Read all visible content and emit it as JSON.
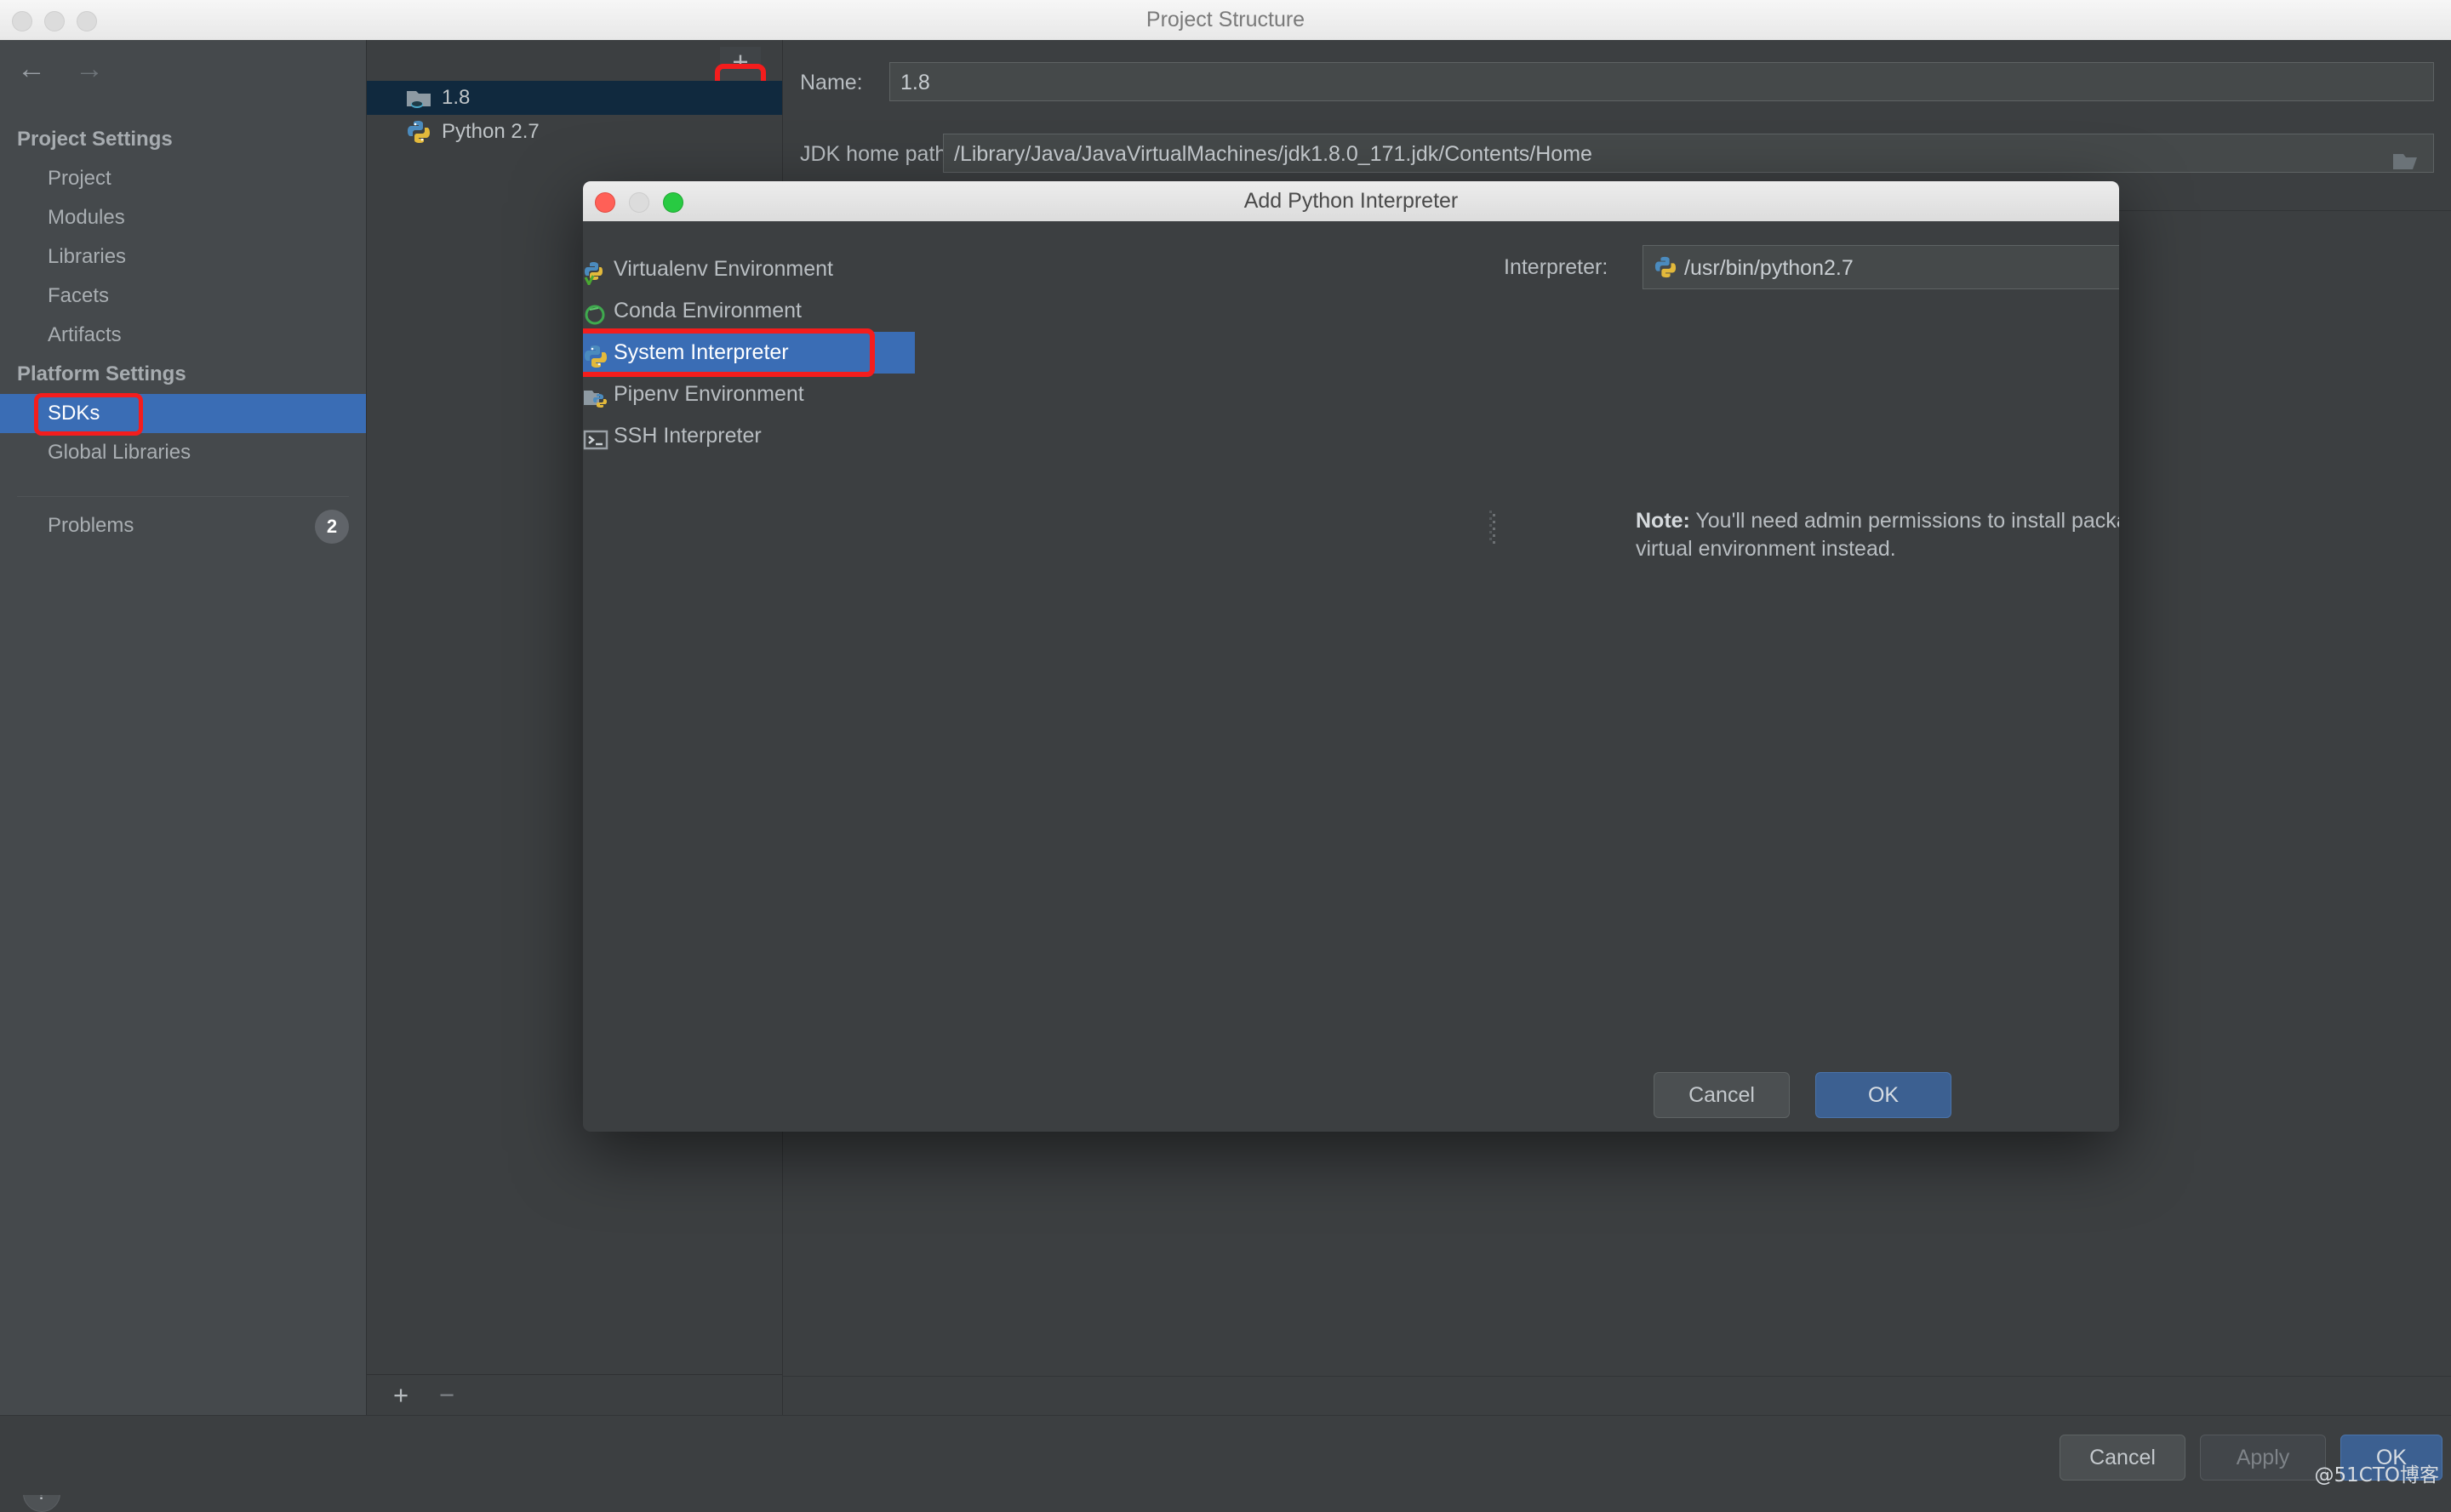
{
  "window": {
    "title": "Project Structure",
    "nav": {
      "back": "←",
      "forward": "→"
    }
  },
  "sidebar": {
    "groups": [
      {
        "label": "Project Settings",
        "items": [
          "Project",
          "Modules",
          "Libraries",
          "Facets",
          "Artifacts"
        ]
      },
      {
        "label": "Platform Settings",
        "items": [
          "SDKs",
          "Global Libraries"
        ]
      }
    ],
    "selected": "SDKs",
    "problems": {
      "label": "Problems",
      "count": "2"
    },
    "help_glyph": "?"
  },
  "sdk_list": {
    "toolbar": {
      "add": "+",
      "remove": "−"
    },
    "items": [
      {
        "name": "1.8",
        "icon": "java-sdk-icon",
        "selected": true
      },
      {
        "name": "Python 2.7",
        "icon": "python-icon",
        "selected": false
      }
    ],
    "bottom_toolbar": {
      "add": "+",
      "remove": "−"
    }
  },
  "detail": {
    "name_label": "Name:",
    "name_value": "1.8",
    "jdk_label": "JDK home path:",
    "jdk_value": "/Library/Java/JavaVirtualMachines/jdk1.8.0_171.jdk/Contents/Home"
  },
  "dialog": {
    "title": "Add Python Interpreter",
    "types": [
      {
        "label": "Virtualenv Environment",
        "icon": "virtualenv-icon",
        "selected": false
      },
      {
        "label": "Conda Environment",
        "icon": "conda-icon",
        "selected": false
      },
      {
        "label": "System Interpreter",
        "icon": "python-icon",
        "selected": true
      },
      {
        "label": "Pipenv Environment",
        "icon": "pipenv-icon",
        "selected": false
      },
      {
        "label": "SSH Interpreter",
        "icon": "terminal-icon",
        "selected": false
      }
    ],
    "interpreter_label": "Interpreter:",
    "interpreter_value": "/usr/bin/python2.7",
    "browse_label": "…",
    "note_prefix": "Note:",
    "note_text": " You'll need admin permissions to install packages for this interpreter. Consider creating a per-project virtual environment instead.",
    "cancel_label": "Cancel",
    "ok_label": "OK"
  },
  "footer": {
    "cancel_label": "Cancel",
    "apply_label": "Apply",
    "ok_label": "OK",
    "watermark": "@51CTO博客"
  },
  "colors": {
    "accent_blue": "#3a6db5",
    "highlight_red": "#f41d1d",
    "panel_bg": "#3c3f41",
    "sidebar_bg": "#45494c",
    "sdk_selected": "#10293e"
  }
}
